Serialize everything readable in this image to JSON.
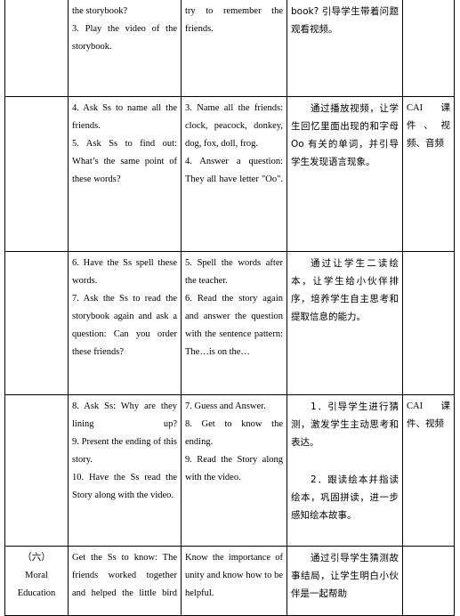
{
  "document": {
    "type": "lesson-plan-table",
    "columns": [
      "stage",
      "teacher_activity",
      "student_activity",
      "design_intent",
      "media"
    ]
  },
  "rows": [
    {
      "id": "row-continuation",
      "stage": "",
      "teacher": [
        "the storybook?",
        "3. Play the video of the storybook."
      ],
      "student": [
        "try to remember the friends."
      ],
      "intent": [
        "book? 引导学生带着问题观看视频。"
      ],
      "media": []
    },
    {
      "id": "row-2",
      "stage": "",
      "teacher": [
        "4. Ask Ss to name all the friends.",
        "5. Ask Ss to find out: What’s the same point of these words?"
      ],
      "student": [
        "3. Name all the friends: clock, peacock, donkey, dog, fox, doll, frog.",
        "4. Answer a question: They all have letter \"Oo\"."
      ],
      "intent": [
        "通过播放视频，让学生回忆里面出现的和字母 Oo 有关的单词，并引导学生发现语言现象。"
      ],
      "media": [
        "CAI 课件、视频、音频"
      ]
    },
    {
      "id": "row-3",
      "stage": "",
      "teacher": [
        "6. Have the Ss spell these words.",
        "7. Ask the Ss to read the storybook again and ask a question: Can you order these friends?"
      ],
      "student": [
        "5. Spell the words after the teacher.",
        "6. Read the story again and answer the question with the sentence pattern: The…is on the…"
      ],
      "intent": [
        "通过让学生二读绘本，让学生给小伙伴排序，培养学生自主思考和提取信息的能力。"
      ],
      "media": []
    },
    {
      "id": "row-4",
      "stage": "",
      "teacher": [
        "8. Ask Ss: Why are they lining up?",
        "9. Present the ending of this story.",
        "10. Have the Ss read the Story along with the video."
      ],
      "student": [
        "7. Guess and Answer.",
        "8. Get to know the ending.",
        "9. Read the Story along with the video."
      ],
      "intent": [
        "1．引导学生进行猜测，激发学生主动思考和表达。",
        "",
        "2．跟读绘本并指读绘本，巩固拼读，进一步感知绘本故事。"
      ],
      "media": [
        "CAI 课件、视频"
      ]
    },
    {
      "id": "row-5",
      "stage_num": "（六）",
      "stage_en_line1": "Moral",
      "stage_en_line2": "Education",
      "teacher": [
        "Get the Ss to know: The friends worked together and helped the little bird"
      ],
      "student": [
        "Know the importance of unity and know how to be helpful."
      ],
      "intent": [
        "通过引导学生猜测故事结局，让学生明白小伙伴是一起帮助"
      ],
      "media": []
    }
  ]
}
